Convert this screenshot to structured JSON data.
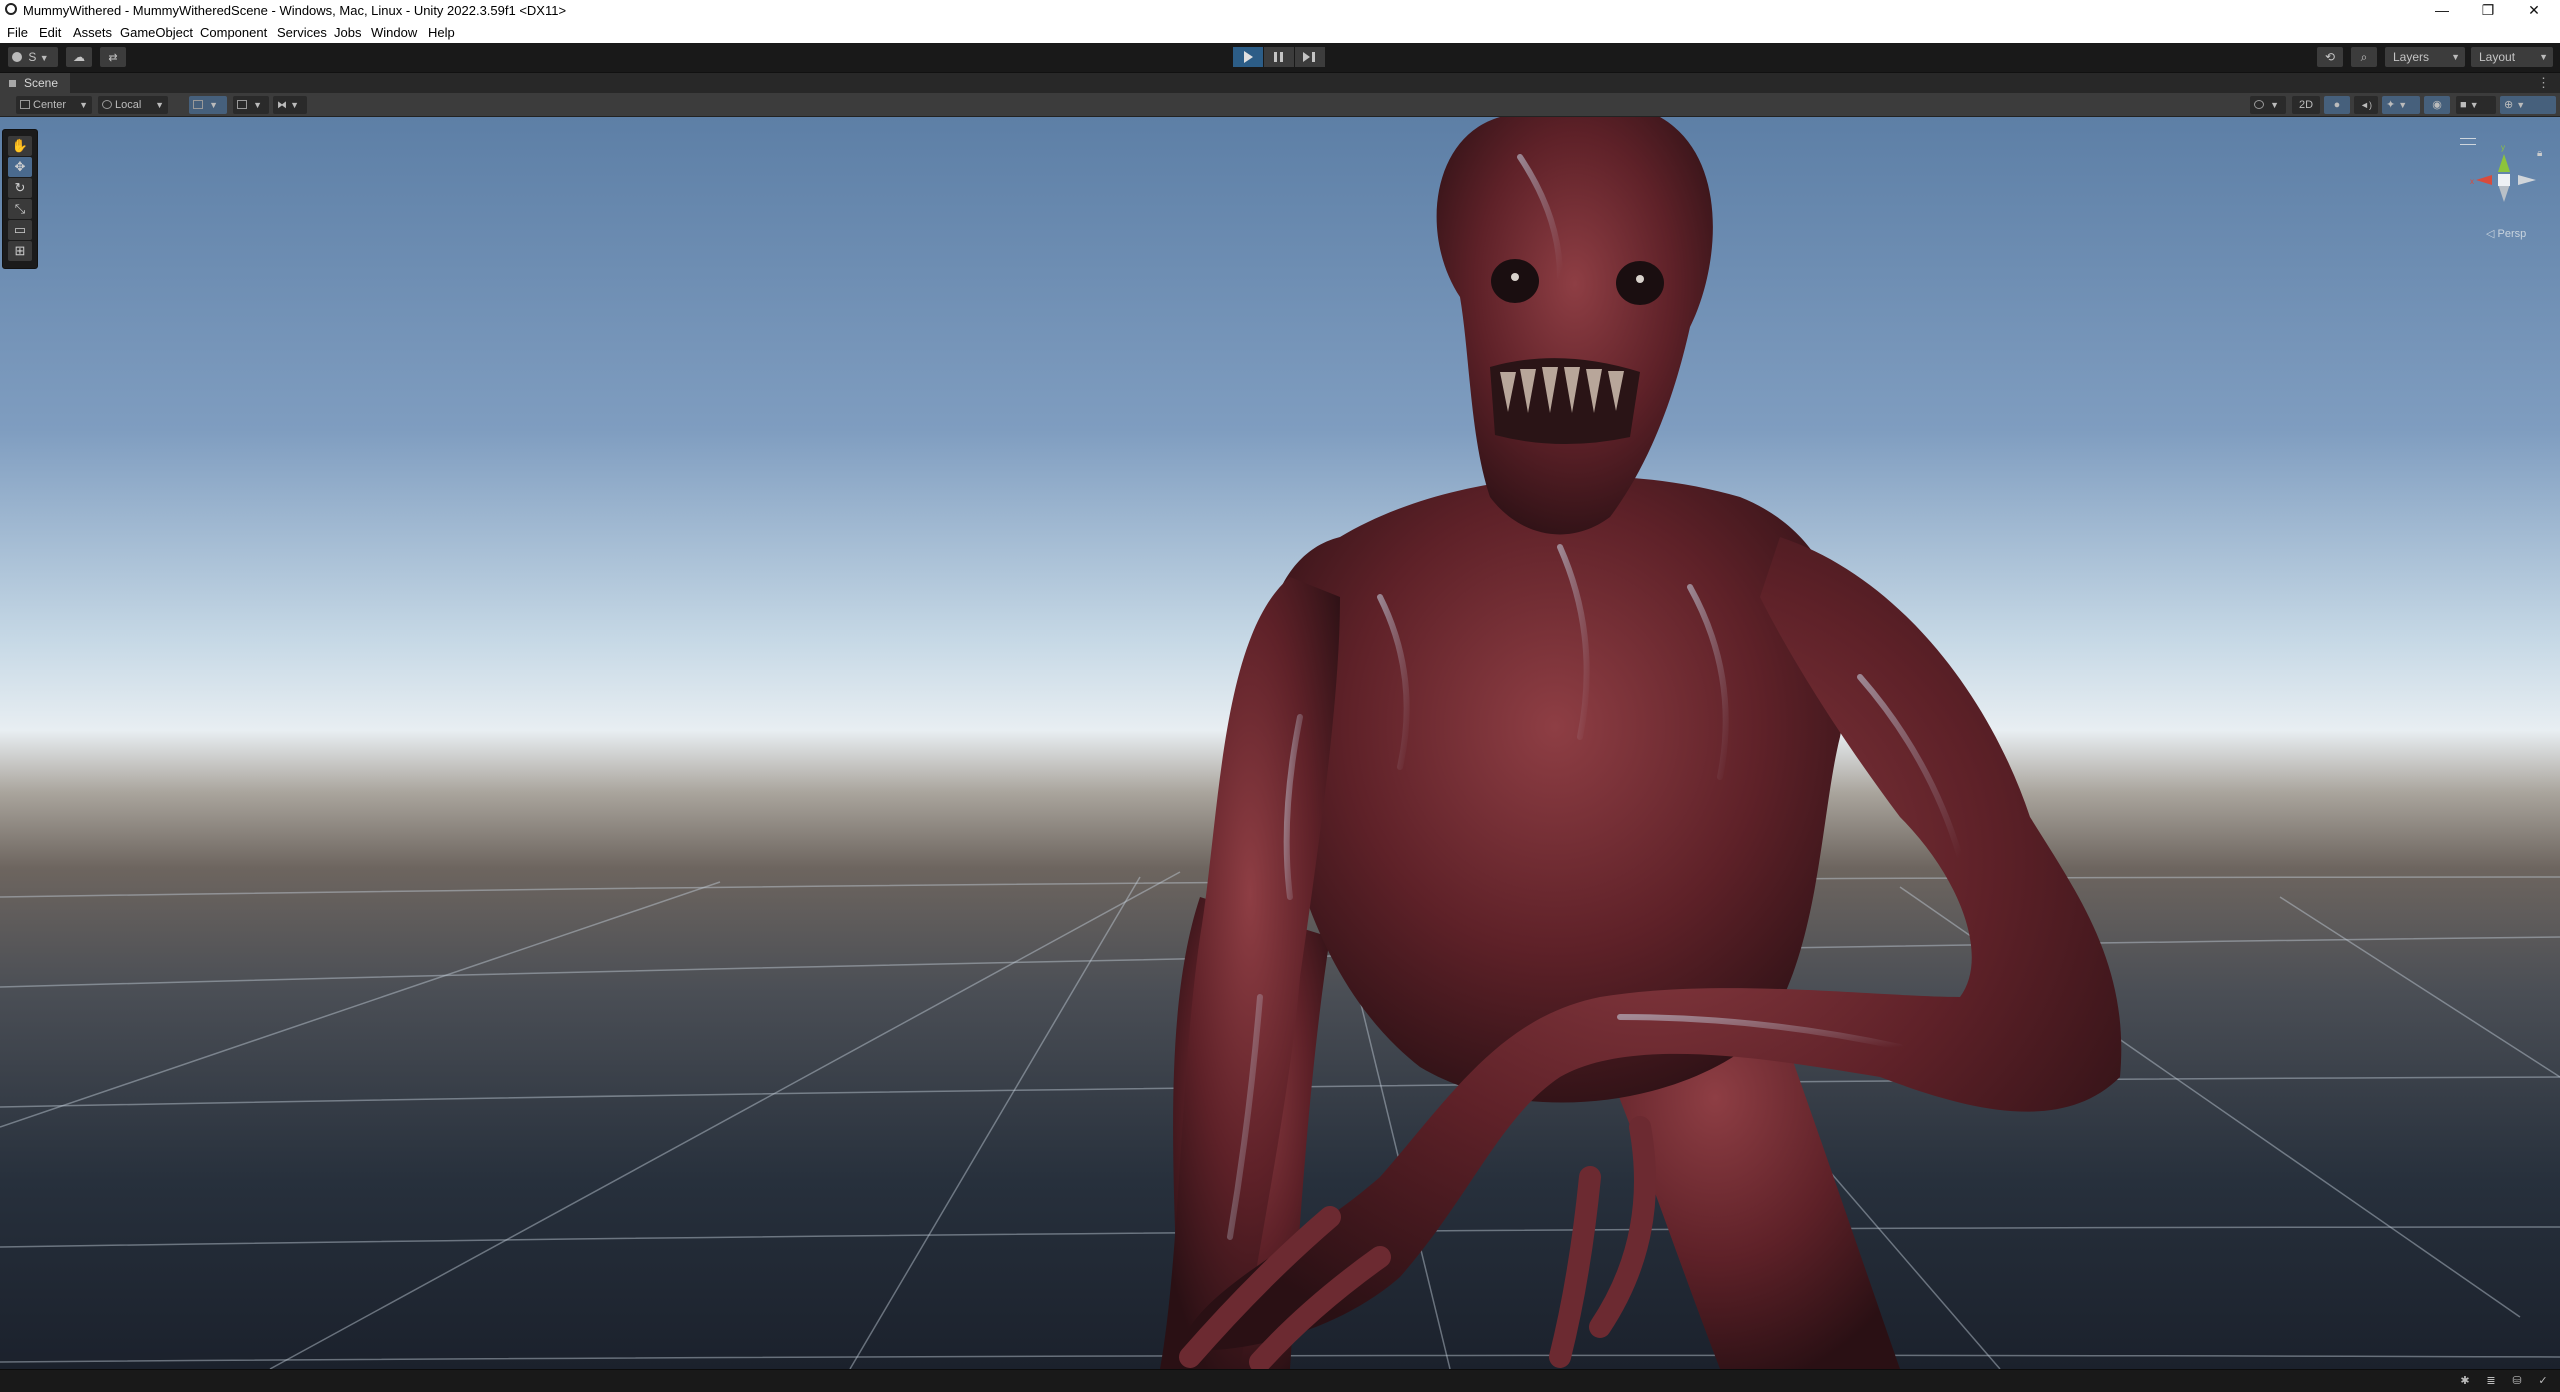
{
  "window": {
    "title": "MummyWithered - MummyWitheredScene - Windows, Mac, Linux - Unity 2022.3.59f1 <DX11>",
    "minimize_glyph": "—",
    "maximize_glyph": "❐",
    "close_glyph": "✕"
  },
  "menu": {
    "items": [
      "File",
      "Edit",
      "Assets",
      "GameObject",
      "Component",
      "Services",
      "Jobs",
      "Window",
      "Help"
    ]
  },
  "toolbar": {
    "account_label": "S",
    "play_state": "playing",
    "layers_label": "Layers",
    "layout_label": "Layout",
    "accent_color": "#2c5d87"
  },
  "scene": {
    "tab_label": "Scene",
    "pivot_mode_label": "Center",
    "pivot_rotation_label": "Local",
    "mode_2d_label": "2D",
    "persp_label": "Persp",
    "tools": [
      "hand-icon",
      "move-icon",
      "rotate-icon",
      "scale-icon",
      "rect-icon",
      "transform-icon"
    ],
    "selected_tool_index": 1
  },
  "status": {
    "icons": [
      "bug-icon",
      "layers-icon",
      "cache-icon",
      "check-icon"
    ]
  }
}
